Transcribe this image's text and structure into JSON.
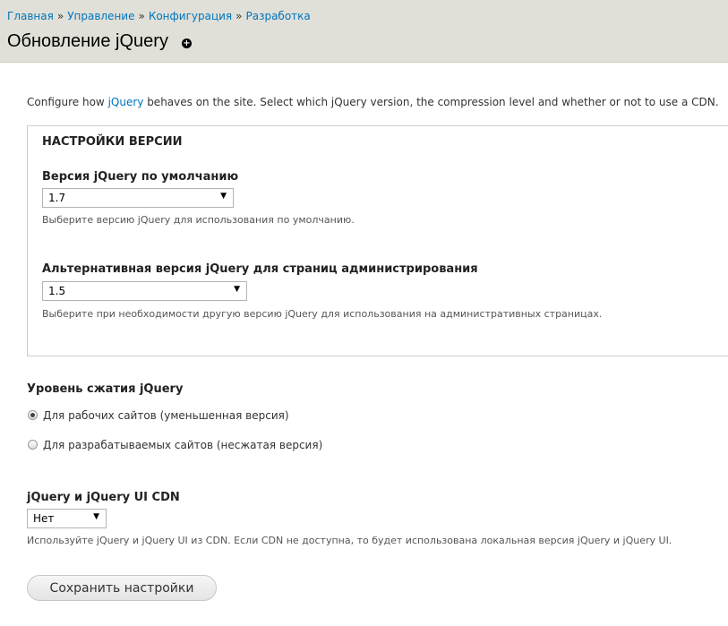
{
  "breadcrumb": [
    {
      "label": "Главная"
    },
    {
      "label": "Управление"
    },
    {
      "label": "Конфигурация"
    },
    {
      "label": "Разработка"
    }
  ],
  "breadcrumb_separator": "»",
  "page_title": "Обновление jQuery",
  "shortcut_icon": "plus-circle-icon",
  "intro": {
    "before": "Configure how ",
    "link": "jQuery",
    "after": " behaves on the site. Select which jQuery version, the compression level and whether or not to use a CDN."
  },
  "version_settings": {
    "legend": "Настройки версии",
    "default_version": {
      "label": "Версия jQuery по умолчанию",
      "value": "1.7",
      "description": "Выберите версию jQuery для использования по умолчанию."
    },
    "admin_version": {
      "label": "Альтернативная версия jQuery для страниц администрирования",
      "value": "1.5",
      "description": "Выберите при необходимости другую версию jQuery для использования на административных страницах."
    }
  },
  "compression": {
    "label": "Уровень сжатия jQuery",
    "options": [
      {
        "label": "Для рабочих сайтов (уменьшенная версия)",
        "checked": true
      },
      {
        "label": "Для разрабатываемых сайтов (несжатая версия)",
        "checked": false
      }
    ]
  },
  "cdn": {
    "label": "jQuery и jQuery UI CDN",
    "value": "Нет",
    "description": "Используйте jQuery и jQuery UI из CDN. Если CDN не доступна, то будет использована локальная версия jQuery и jQuery UI."
  },
  "save_label": "Сохранить настройки",
  "colors": {
    "link": "#0074bd",
    "header_bg": "#e0e0d8"
  }
}
